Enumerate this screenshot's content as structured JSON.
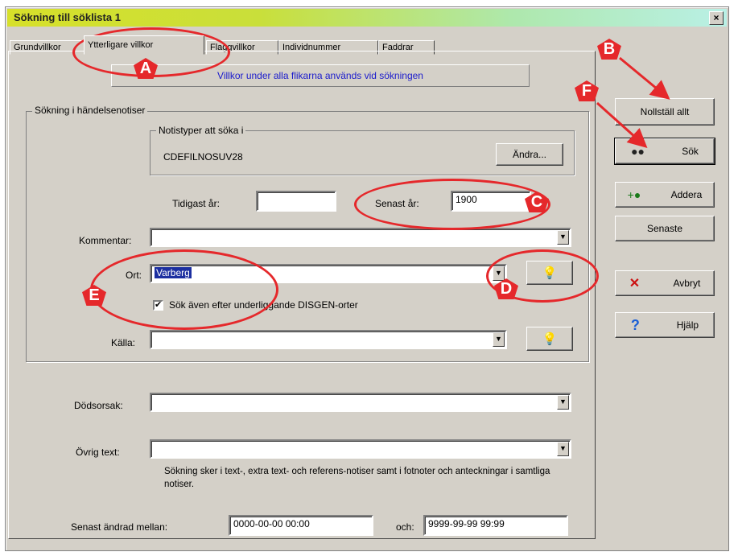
{
  "window": {
    "title": "Sökning till söklista 1",
    "close_glyph": "×"
  },
  "tabs": [
    {
      "label": "Grundvillkor"
    },
    {
      "label": "Ytterligare villkor",
      "active": true
    },
    {
      "label": "Flaggvillkor"
    },
    {
      "label": "Individnummer"
    },
    {
      "label": "Faddrar"
    }
  ],
  "banner": "Villkor under alla flikarna används vid sökningen",
  "event_group": {
    "title": "Sökning i händelsenotiser",
    "note_types": {
      "title": "Notistyper att söka i",
      "value": "CDEFILNOSUV28",
      "change_button": "Ändra..."
    },
    "earliest_year": {
      "label": "Tidigast år:",
      "value": ""
    },
    "latest_year": {
      "label": "Senast år:",
      "value": "1900"
    },
    "comment": {
      "label": "Kommentar:",
      "value": ""
    },
    "place": {
      "label": "Ort:",
      "value": "Varberg"
    },
    "sub_places_checkbox": {
      "label": "Sök även efter underliggande DISGEN-orter",
      "checked": true
    },
    "source": {
      "label": "Källa:",
      "value": ""
    }
  },
  "cause_of_death": {
    "label": "Dödsorsak:",
    "value": ""
  },
  "other_text": {
    "label": "Övrig text:",
    "value": ""
  },
  "other_text_hint": "Sökning sker i text-, extra text- och referens-notiser samt i fotnoter och anteckningar i samtliga notiser.",
  "last_modified": {
    "label": "Senast ändrad mellan:",
    "from": "0000-00-00 00:00",
    "and_label": "och:",
    "to": "9999-99-99 99:99"
  },
  "buttons": {
    "reset_all": "Nollställ allt",
    "search": "Sök",
    "add": "Addera",
    "latest": "Senaste",
    "cancel": "Avbryt",
    "help": "Hjälp"
  },
  "icons": {
    "search": "binoculars-icon",
    "add": "binoculars-plus-icon",
    "cancel": "x-icon",
    "help": "question-icon",
    "place_lookup": "lightbulb-icon",
    "source_lookup": "lightbulb-icon"
  },
  "markers": [
    "A",
    "B",
    "C",
    "D",
    "E",
    "F"
  ],
  "colors": {
    "annotation": "#e5282b",
    "banner_text": "#1a1acc",
    "selection": "#1c2fa0"
  }
}
